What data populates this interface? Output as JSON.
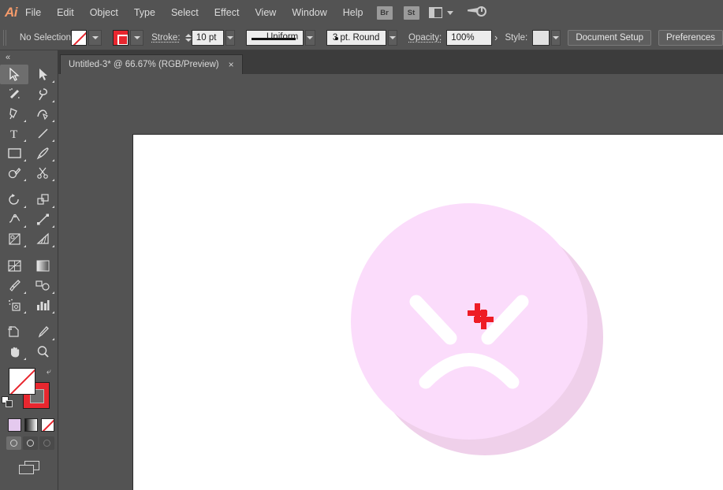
{
  "app": {
    "name": "Adobe Illustrator",
    "logo_text": "Ai"
  },
  "menubar": {
    "items": [
      {
        "label": "File"
      },
      {
        "label": "Edit"
      },
      {
        "label": "Object"
      },
      {
        "label": "Type"
      },
      {
        "label": "Select"
      },
      {
        "label": "Effect"
      },
      {
        "label": "View"
      },
      {
        "label": "Window"
      },
      {
        "label": "Help"
      }
    ],
    "bridge_button": "Br",
    "stock_button": "St",
    "arrange_documents_icon": "arrange-documents-icon",
    "workspace_switcher_icon": "workspace-switcher-icon"
  },
  "controlbar": {
    "selection_status": "No Selection",
    "fill_swatch": {
      "name": "fill-swatch",
      "value": "None"
    },
    "stroke_swatch": {
      "name": "stroke-swatch",
      "value": "#E8272F"
    },
    "stroke_label": "Stroke:",
    "stroke_weight": "10 pt",
    "stroke_profile": "Uniform",
    "brush_definition": "3 pt. Round",
    "opacity_label": "Opacity:",
    "opacity_value": "100%",
    "style_label": "Style:",
    "style_swatch": "#E2E2E2",
    "document_setup_button": "Document Setup",
    "preferences_button": "Preferences"
  },
  "tabbar": {
    "document_tab": "Untitled-3* @ 66.67% (RGB/Preview)",
    "close_glyph": "×"
  },
  "toolbar": {
    "collapse_glyph": "«",
    "tools": [
      {
        "name": "selection-tool",
        "active": true
      },
      {
        "name": "direct-selection-tool",
        "active": false
      },
      {
        "name": "magic-wand-tool",
        "active": false
      },
      {
        "name": "lasso-tool",
        "active": false
      },
      {
        "name": "pen-tool",
        "active": false
      },
      {
        "name": "curvature-tool",
        "active": false
      },
      {
        "name": "type-tool",
        "active": false
      },
      {
        "name": "line-segment-tool",
        "active": false
      },
      {
        "name": "rectangle-tool",
        "active": false
      },
      {
        "name": "paintbrush-tool",
        "active": false
      },
      {
        "name": "shaper-pencil-tool",
        "active": false
      },
      {
        "name": "scissors-tool",
        "active": false
      },
      {
        "name": "rotate-tool",
        "active": false
      },
      {
        "name": "scale-tool",
        "active": false
      },
      {
        "name": "width-tool",
        "active": false
      },
      {
        "name": "free-transform-tool",
        "active": false
      },
      {
        "name": "shape-builder-tool",
        "active": false
      },
      {
        "name": "perspective-grid-tool",
        "active": false
      },
      {
        "name": "mesh-tool",
        "active": false
      },
      {
        "name": "gradient-tool",
        "active": false
      },
      {
        "name": "eyedropper-tool",
        "active": false
      },
      {
        "name": "blend-tool",
        "active": false
      },
      {
        "name": "symbol-sprayer-tool",
        "active": false
      },
      {
        "name": "column-graph-tool",
        "active": false
      },
      {
        "name": "artboard-tool",
        "active": false
      },
      {
        "name": "slice-tool",
        "active": false
      },
      {
        "name": "hand-tool",
        "active": false
      },
      {
        "name": "zoom-tool",
        "active": false
      }
    ],
    "fill_color": "None",
    "stroke_color": "#E8272F",
    "swap_glyph": "⤶",
    "mini_swatches": [
      {
        "name": "color-button",
        "color": "#E4C9EE"
      },
      {
        "name": "gradient-button",
        "color": "#000000"
      },
      {
        "name": "none-button",
        "color": "None"
      }
    ],
    "draw_modes": [
      "draw-normal",
      "draw-behind",
      "draw-inside"
    ],
    "screen_mode": "change-screen-mode"
  },
  "artwork": {
    "description": "Angry face emoji illustration",
    "back_circle_color": "#EFD0EA",
    "front_circle_color": "#FBDCFB",
    "feature_color": "#FFFFFF",
    "cursor": "paintbrush-crosshair-cursor",
    "cursor_color": "#EE1C25"
  }
}
